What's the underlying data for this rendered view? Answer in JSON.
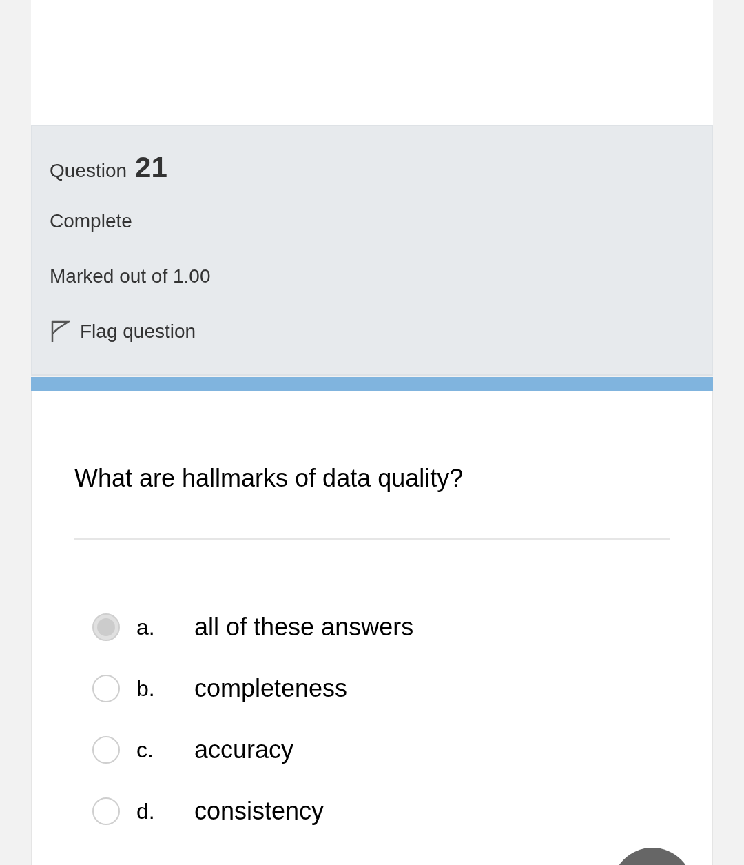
{
  "question_info": {
    "label": "Question",
    "number": "21",
    "state": "Complete",
    "marks": "Marked out of 1.00",
    "flag": {
      "label": "Flag question",
      "flagged": false
    }
  },
  "question": {
    "text": "What are hallmarks of data quality?",
    "options": [
      {
        "letter": "a.",
        "text": "all of these answers",
        "selected": true
      },
      {
        "letter": "b.",
        "text": "completeness",
        "selected": false
      },
      {
        "letter": "c.",
        "text": "accuracy",
        "selected": false
      },
      {
        "letter": "d.",
        "text": "consistency",
        "selected": false
      }
    ]
  }
}
